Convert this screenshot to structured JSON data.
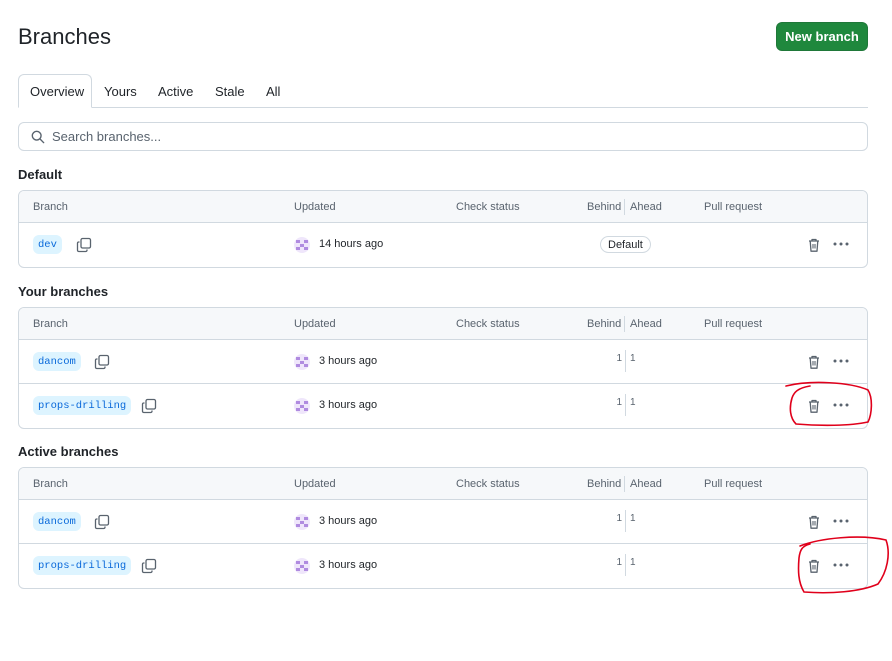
{
  "header": {
    "title": "Branches",
    "new_branch_label": "New branch"
  },
  "tabs": [
    {
      "label": "Overview",
      "selected": true
    },
    {
      "label": "Yours",
      "selected": false
    },
    {
      "label": "Active",
      "selected": false
    },
    {
      "label": "Stale",
      "selected": false
    },
    {
      "label": "All",
      "selected": false
    }
  ],
  "search": {
    "placeholder": "Search branches..."
  },
  "columns": {
    "branch": "Branch",
    "updated": "Updated",
    "check_status": "Check status",
    "behind": "Behind",
    "ahead": "Ahead",
    "pull_request": "Pull request"
  },
  "sections": {
    "default": {
      "title": "Default",
      "rows": [
        {
          "name": "dev",
          "updated": "14 hours ago",
          "badge": "Default"
        }
      ]
    },
    "yours": {
      "title": "Your branches",
      "rows": [
        {
          "name": "dancom",
          "updated": "3 hours ago",
          "behind": "1",
          "ahead": "1"
        },
        {
          "name": "props-drilling",
          "updated": "3 hours ago",
          "behind": "1",
          "ahead": "1"
        }
      ]
    },
    "active": {
      "title": "Active branches",
      "rows": [
        {
          "name": "dancom",
          "updated": "3 hours ago",
          "behind": "1",
          "ahead": "1"
        },
        {
          "name": "props-drilling",
          "updated": "3 hours ago",
          "behind": "1",
          "ahead": "1"
        }
      ]
    }
  },
  "icons": {
    "search": "search-icon",
    "copy": "copy-icon",
    "trash": "trash-icon",
    "more": "kebab-horizontal-icon",
    "avatar": "user-avatar"
  },
  "colors": {
    "primary_button": "#1f883d",
    "branch_bg": "#ddf4ff",
    "branch_text": "#0969da",
    "annotation": "#e0001b"
  }
}
